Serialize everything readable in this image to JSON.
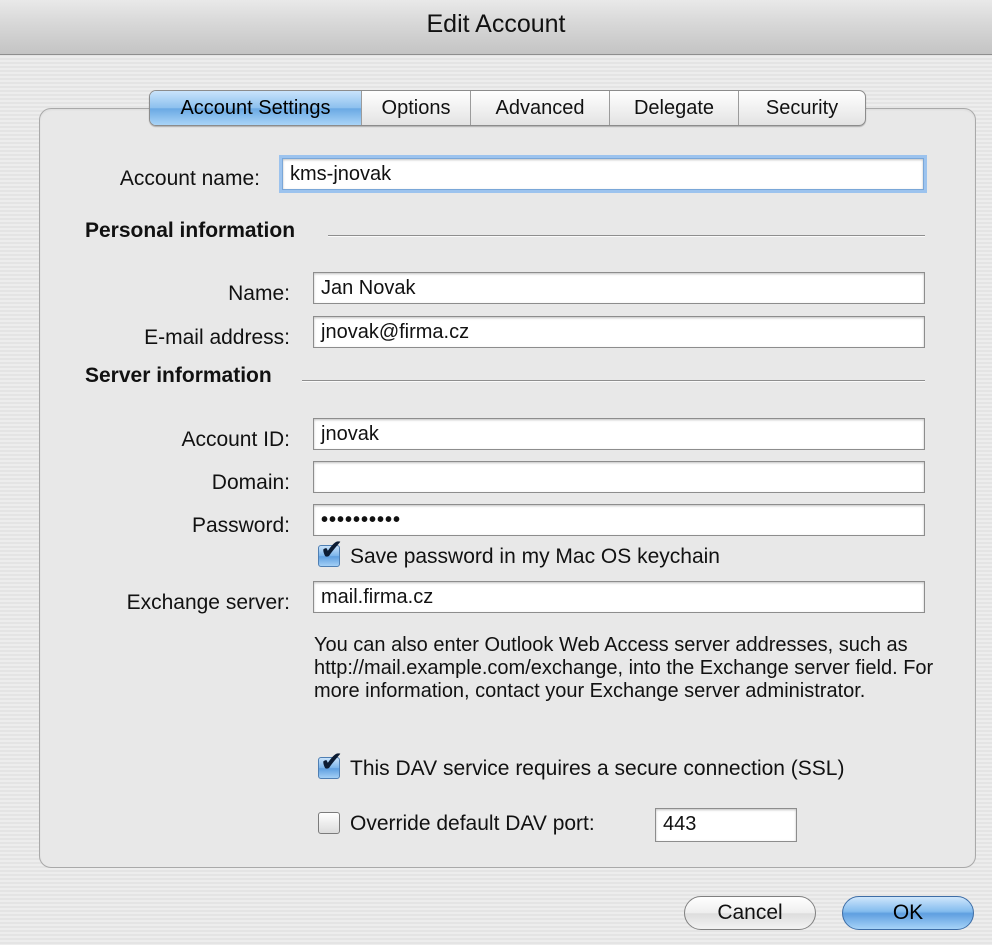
{
  "window": {
    "title": "Edit Account"
  },
  "tabs": [
    {
      "label": "Account Settings",
      "active": true
    },
    {
      "label": "Options",
      "active": false
    },
    {
      "label": "Advanced",
      "active": false
    },
    {
      "label": "Delegate",
      "active": false
    },
    {
      "label": "Security",
      "active": false
    }
  ],
  "account": {
    "label": "Account name:",
    "value": "kms-jnovak"
  },
  "personal": {
    "heading": "Personal information",
    "name_label": "Name:",
    "name_value": "Jan Novak",
    "email_label": "E-mail address:",
    "email_value": "jnovak@firma.cz"
  },
  "server": {
    "heading": "Server information",
    "account_id_label": "Account ID:",
    "account_id_value": "jnovak",
    "domain_label": "Domain:",
    "domain_value": "",
    "password_label": "Password:",
    "password_value": "••••••••••",
    "save_password": {
      "label": "Save password in my Mac OS keychain",
      "checked": true
    },
    "exchange_label": "Exchange server:",
    "exchange_value": "mail.firma.cz",
    "help_text": "You can also enter Outlook Web Access server addresses, such as http://mail.example.com/exchange, into the Exchange server field. For more information, contact your Exchange server administrator.",
    "ssl": {
      "label": "This DAV service requires a secure connection (SSL)",
      "checked": true
    },
    "override_port": {
      "label": "Override default DAV port:",
      "checked": false
    },
    "port_value": "443"
  },
  "buttons": {
    "cancel": "Cancel",
    "ok": "OK"
  },
  "colors": {
    "accent": "#6aa9e4",
    "background": "#ececec"
  }
}
